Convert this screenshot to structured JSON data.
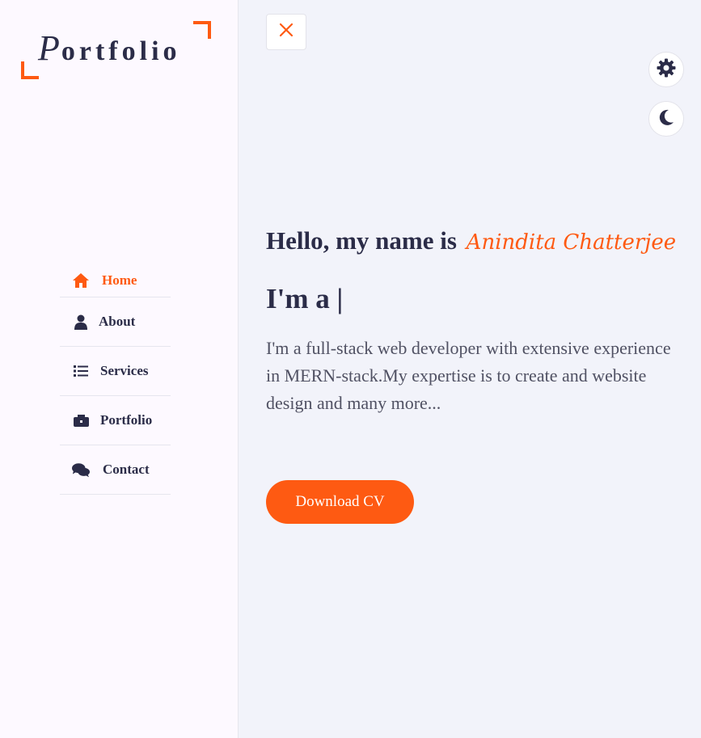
{
  "colors": {
    "accent": "#fe5a12",
    "text_dark": "#2b2c48",
    "text_muted": "#505163",
    "sidebar_bg": "#fdf9ff",
    "main_bg": "#f2f3fa"
  },
  "logo": {
    "first_letter": "P",
    "rest": "ortfolio"
  },
  "nav": [
    {
      "label": "Home",
      "icon": "home-icon",
      "active": true
    },
    {
      "label": "About",
      "icon": "user-icon",
      "active": false
    },
    {
      "label": "Services",
      "icon": "list-icon",
      "active": false
    },
    {
      "label": "Portfolio",
      "icon": "briefcase-icon",
      "active": false
    },
    {
      "label": "Contact",
      "icon": "chat-icon",
      "active": false
    }
  ],
  "toolbar": {
    "close_icon": "close-icon",
    "settings_icon": "gear-icon",
    "theme_icon": "moon-icon"
  },
  "hero": {
    "greeting": "Hello, my name is",
    "name": "Anindita Chatterjee",
    "typing": "I'm a |",
    "description": "I'm a full-stack web developer with extensive experience in MERN-stack.My expertise is to create and website design and many more...",
    "cta": "Download CV"
  }
}
